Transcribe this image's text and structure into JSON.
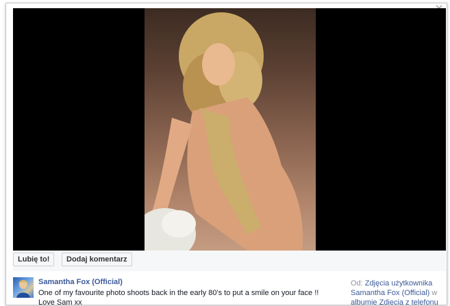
{
  "actions": {
    "like_label": "Lubię to!",
    "comment_label": "Dodaj komentarz"
  },
  "post": {
    "author": "Samantha Fox (Official)",
    "caption": "One of my favourite photo shoots back in the early 80's to put a smile on your face !! Love Sam xx",
    "source_prefix": "Od:",
    "source_link_1": "Zdjęcia użytkownika",
    "source_link_2": "Samantha Fox (Official)",
    "source_mid": "w",
    "source_line_3": "albumie Zdjęcia z telefonu"
  },
  "icons": {
    "close": "close-icon",
    "avatar": "avatar"
  },
  "colors": {
    "link": "#3b5998",
    "muted": "#90949c",
    "stage": "#000000",
    "action_bar": "#f6f7f8"
  }
}
